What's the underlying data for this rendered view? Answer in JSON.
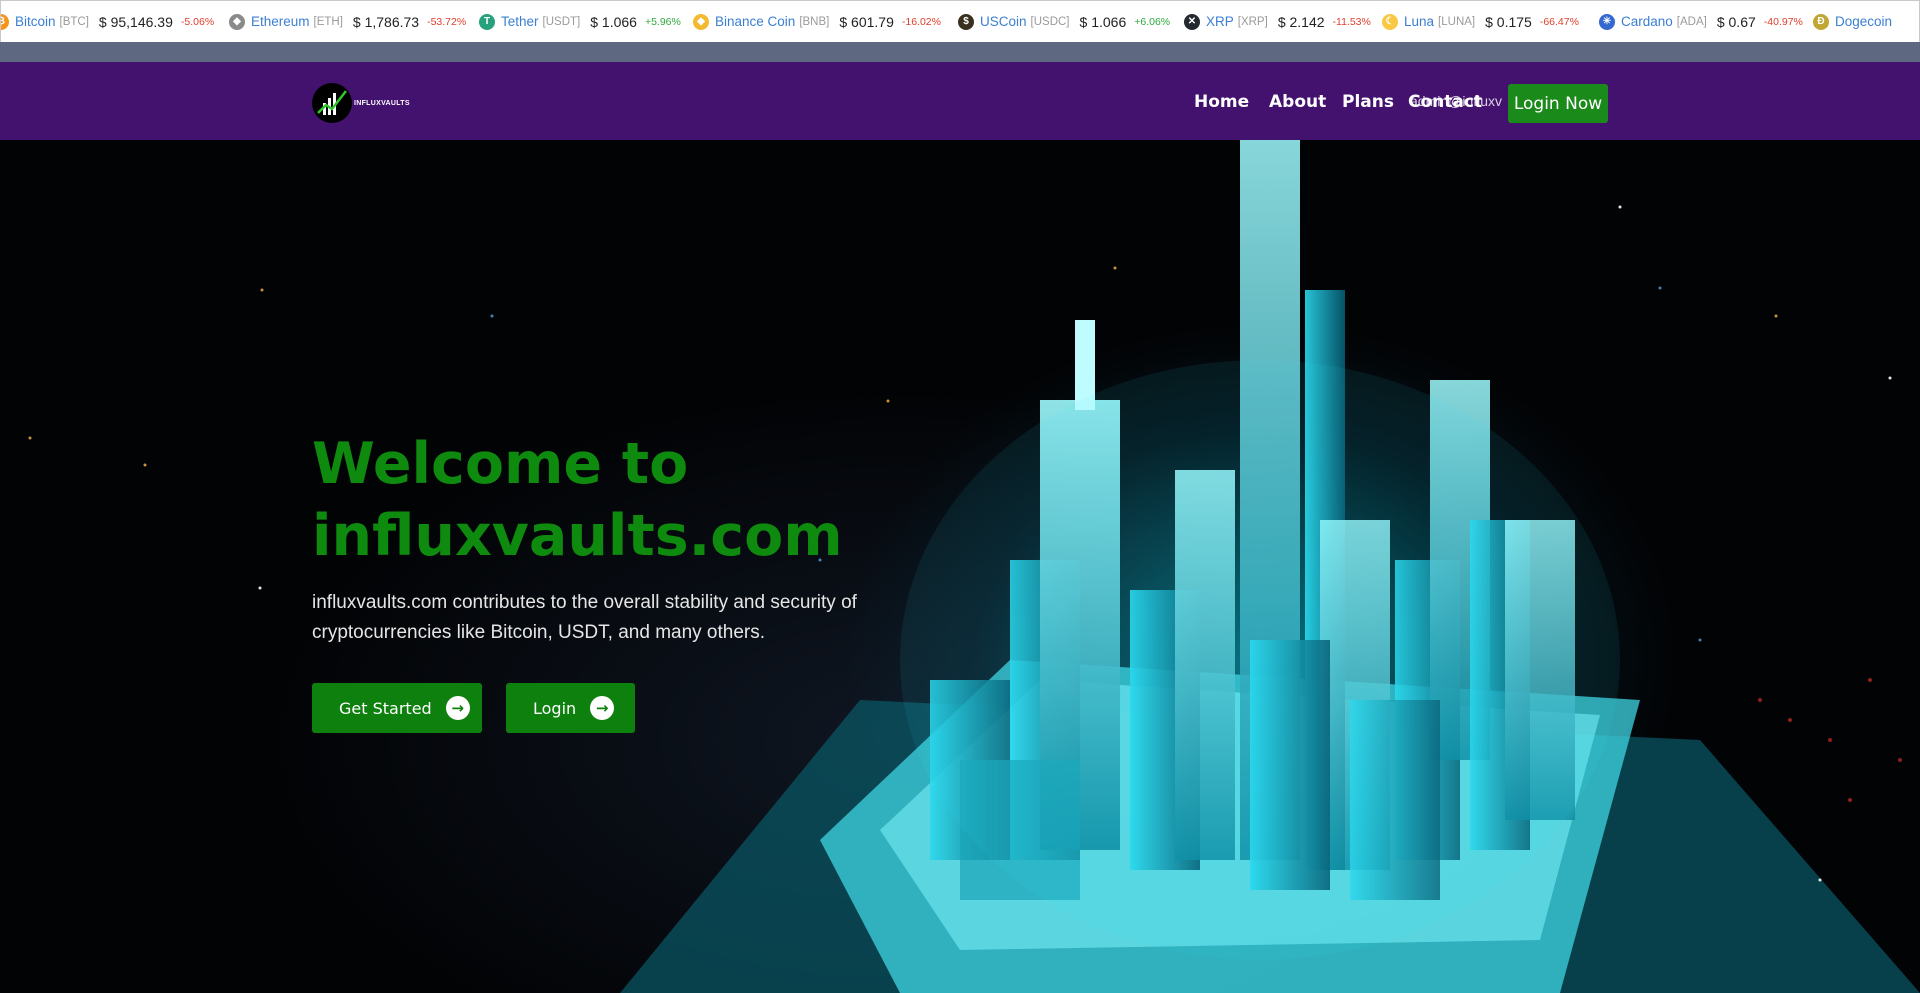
{
  "ticker": [
    {
      "name": "Bitcoin",
      "symbol": "[BTC]",
      "price": "$ 95,146.39",
      "change": "-5.06%",
      "dir": "neg",
      "icon": "bitcoin-icon",
      "color": "#f7931a",
      "glyph": "₿"
    },
    {
      "name": "Ethereum",
      "symbol": "[ETH]",
      "price": "$ 1,786.73",
      "change": "-53.72%",
      "dir": "neg",
      "icon": "ethereum-icon",
      "color": "#8a8a8a",
      "glyph": "◆"
    },
    {
      "name": "Tether",
      "symbol": "[USDT]",
      "price": "$ 1.066",
      "change": "+5.96%",
      "dir": "pos",
      "icon": "tether-icon",
      "color": "#26a17b",
      "glyph": "T"
    },
    {
      "name": "Binance Coin",
      "symbol": "[BNB]",
      "price": "$ 601.79",
      "change": "-16.02%",
      "dir": "neg",
      "icon": "binance-icon",
      "color": "#f3ba2f",
      "glyph": "◆"
    },
    {
      "name": "USCoin",
      "symbol": "[USDC]",
      "price": "$ 1.066",
      "change": "+6.06%",
      "dir": "pos",
      "icon": "usdc-icon",
      "color": "#3a3020",
      "glyph": "$"
    },
    {
      "name": "XRP",
      "symbol": "[XRP]",
      "price": "$ 2.142",
      "change": "-11.53%",
      "dir": "neg",
      "icon": "xrp-icon",
      "color": "#23292f",
      "glyph": "✕"
    },
    {
      "name": "Luna",
      "symbol": "[LUNA]",
      "price": "$ 0.175",
      "change": "-66.47%",
      "dir": "neg",
      "icon": "luna-icon",
      "color": "#f9c943",
      "glyph": "☾"
    },
    {
      "name": "Cardano",
      "symbol": "[ADA]",
      "price": "$ 0.67",
      "change": "-40.97%",
      "dir": "neg",
      "icon": "cardano-icon",
      "color": "#3468d1",
      "glyph": "✳"
    },
    {
      "name": "Dogecoin",
      "symbol": "",
      "price": "",
      "change": "",
      "dir": "neg",
      "icon": "dogecoin-icon",
      "color": "#c2a633",
      "glyph": "Ð"
    }
  ],
  "brand": {
    "logo_text": "INFLUXVAULTS"
  },
  "nav": {
    "home": "Home",
    "about": "About",
    "plans": "Plans",
    "contact": "Contact",
    "email": "admin@influxv",
    "login_now": "Login Now"
  },
  "hero": {
    "title": "Welcome to influxvaults.com",
    "description": "influxvaults.com contributes to the overall stability and security of cryptocurrencies like Bitcoin, USDT, and many others.",
    "get_started": "Get Started",
    "login": "Login",
    "arrow_icon": "arrow-right-icon"
  },
  "colors": {
    "nav_bg": "#43126f",
    "accent_green": "#0d800d",
    "title_green": "#0e8a0e",
    "ticker_link": "#3b7fd1"
  }
}
